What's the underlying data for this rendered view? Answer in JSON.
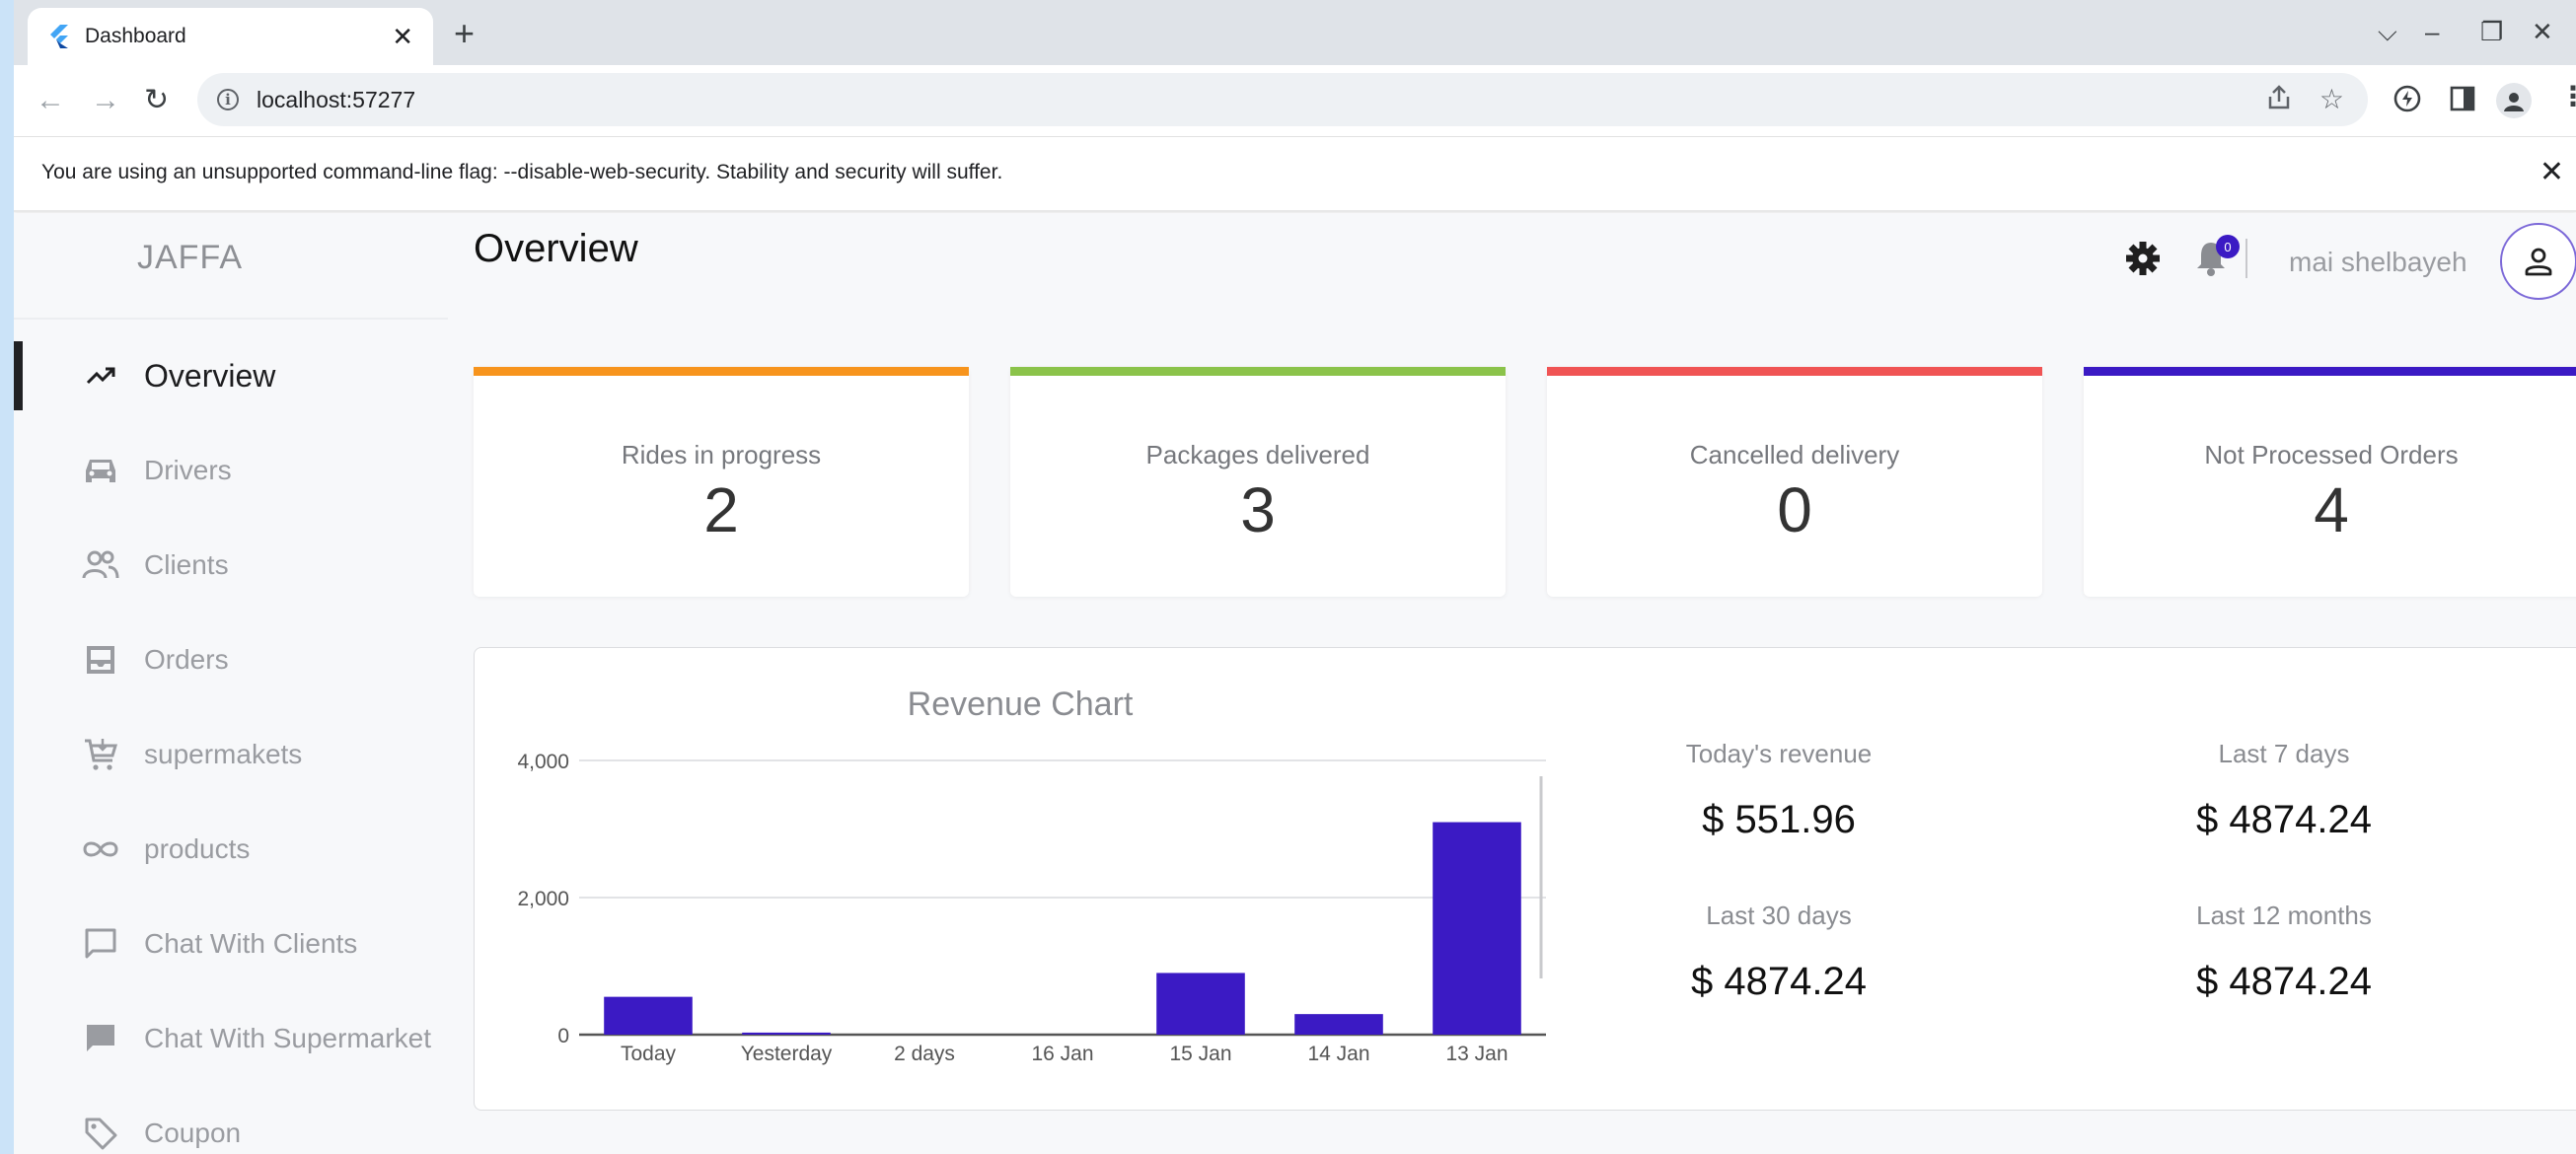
{
  "browser": {
    "tab_title": "Dashboard",
    "url": "localhost:57277",
    "infobar_text": "You are using an unsupported command-line flag: --disable-web-security. Stability and security will suffer."
  },
  "sidebar": {
    "brand": "JAFFA",
    "items": [
      {
        "label": "Overview",
        "icon": "trending-up-icon",
        "active": true
      },
      {
        "label": "Drivers",
        "icon": "car-icon",
        "active": false
      },
      {
        "label": "Clients",
        "icon": "users-icon",
        "active": false
      },
      {
        "label": "Orders",
        "icon": "inbox-icon",
        "active": false
      },
      {
        "label": "supermakets",
        "icon": "cart-icon",
        "active": false
      },
      {
        "label": "products",
        "icon": "infinity-icon",
        "active": false
      },
      {
        "label": "Chat With Clients",
        "icon": "chat-outline-icon",
        "active": false
      },
      {
        "label": "Chat With Supermarket",
        "icon": "chat-filled-icon",
        "active": false
      },
      {
        "label": "Coupon",
        "icon": "tag-icon",
        "active": false
      }
    ]
  },
  "header": {
    "title": "Overview",
    "notification_count": "0",
    "user_name": "mai shelbayeh"
  },
  "stats": [
    {
      "label": "Rides in progress",
      "value": "2",
      "color": "#f7941d"
    },
    {
      "label": "Packages delivered",
      "value": "3",
      "color": "#8bc34a"
    },
    {
      "label": "Cancelled delivery",
      "value": "0",
      "color": "#f05454"
    },
    {
      "label": "Not Processed Orders",
      "value": "4",
      "color": "#3b1ac4"
    }
  ],
  "revenue": {
    "today_label": "Today's revenue",
    "today_value": "$ 551.96",
    "last7_label": "Last 7 days",
    "last7_value": "$ 4874.24",
    "last30_label": "Last 30 days",
    "last30_value": "$ 4874.24",
    "last12_label": "Last 12 months",
    "last12_value": "$ 4874.24"
  },
  "chart_data": {
    "type": "bar",
    "title": "Revenue Chart",
    "categories": [
      "Today",
      "Yesterday",
      "2 days",
      "16 Jan",
      "15 Jan",
      "14 Jan",
      "13 Jan"
    ],
    "values": [
      552,
      30,
      0,
      0,
      900,
      300,
      3100
    ],
    "ylim": [
      0,
      4000
    ],
    "yticks": [
      "0",
      "2,000",
      "4,000"
    ],
    "ytick_values": [
      0,
      2000,
      4000
    ],
    "grid": true,
    "bar_color": "#3b1ac4"
  }
}
